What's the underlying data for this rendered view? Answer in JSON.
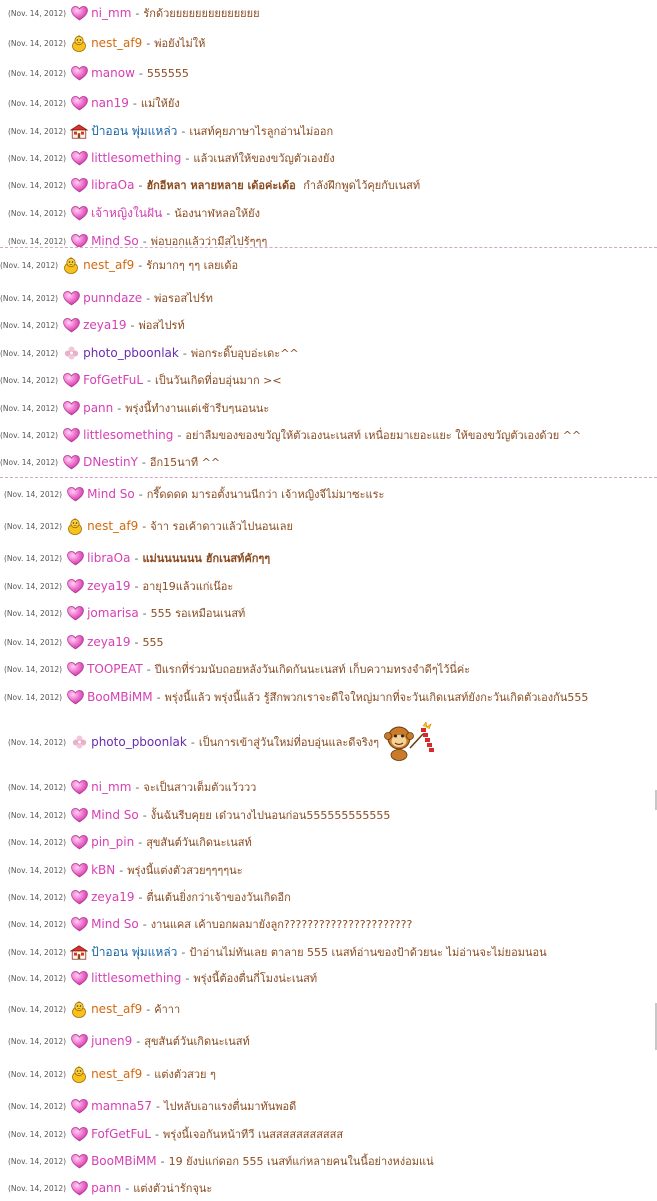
{
  "panels": [
    {
      "rows": [
        {
          "date": "(Nov. 14, 2012)",
          "icon": "heart-icon",
          "name": "ni_mm",
          "color": "pink",
          "msg": "รักด้วยยยยยยยยยยยยยย"
        },
        {
          "date": "(Nov. 14, 2012)",
          "icon": "duck-icon",
          "name": "nest_af9",
          "color": "orange",
          "msg": "พ่อยังไม่ให้"
        },
        {
          "date": "(Nov. 14, 2012)",
          "icon": "heart-icon",
          "name": "manow",
          "color": "pink",
          "msg": "555555"
        },
        {
          "date": "(Nov. 14, 2012)",
          "icon": "heart-icon",
          "name": "nan19",
          "color": "pink",
          "msg": "แม่ให้ยัง"
        },
        {
          "date": "(Nov. 14, 2012)",
          "icon": "house-icon",
          "name": "ป้าออน พุ่มแหล่ว",
          "color": "blue",
          "msg": "เนสท์คุยภาษาไรลูกอ่านไม่ออก"
        },
        {
          "date": "(Nov. 14, 2012)",
          "icon": "heart-icon",
          "name": "littlesomething",
          "color": "pink",
          "msg": "แล้วเนสท์ให้ของขวัญตัวเองยัง"
        },
        {
          "date": "(Nov. 14, 2012)",
          "icon": "heart-icon",
          "name": "libraOa",
          "color": "pink",
          "msg": "ฮักอีหลา หลายหลาย เด้อค่ะเด้อ",
          "msg_tail": "กำลังฝึกพูดไว้คุยกับเนสท์",
          "bold": true
        },
        {
          "date": "(Nov. 14, 2012)",
          "icon": "heart-icon",
          "name": "เจ้าหญิงในฝัน",
          "color": "pink",
          "msg": "น้องนาฬหลอให้ยัง"
        },
        {
          "date": "(Nov. 14, 2012)",
          "icon": "heart-icon",
          "name": "Mind So",
          "color": "pink",
          "msg": "พ่อบอกแล้วว่ามีสไปร้ๆๆๆ"
        }
      ]
    },
    {
      "rows": [
        {
          "date": "(Nov. 14, 2012)",
          "icon": "duck-icon",
          "name": "nest_af9",
          "color": "orange",
          "msg": "รักมากๆ ๆๆ เลยเด้อ"
        },
        {
          "date": "(Nov. 14, 2012)",
          "icon": "heart-icon",
          "name": "punndaze",
          "color": "pink",
          "msg": "พ่อรอสไปร์ท"
        },
        {
          "date": "(Nov. 14, 2012)",
          "icon": "heart-icon",
          "name": "zeya19",
          "color": "pink",
          "msg": "พ่อสไปรท์"
        },
        {
          "date": "(Nov. 14, 2012)",
          "icon": "flower-icon",
          "name": "photo_pboonlak",
          "color": "purple",
          "msg": "พ่อกระดิ๊บอุบอ่ะเดะ^^"
        },
        {
          "date": "(Nov. 14, 2012)",
          "icon": "heart-icon",
          "name": "FofGetFuL",
          "color": "pink",
          "msg": "เป็นวันเกิดที่อบอุ่นมาก ><"
        },
        {
          "date": "(Nov. 14, 2012)",
          "icon": "heart-icon",
          "name": "pann",
          "color": "pink",
          "msg": "พรุ่งนี้ทำงานแต่เช้ารีบๆนอนนะ"
        },
        {
          "date": "(Nov. 14, 2012)",
          "icon": "heart-icon",
          "name": "littlesomething",
          "color": "pink",
          "msg": "อย่าลืมของของขวัญให้ตัวเองนะเนสท์ เหนื่อยมาเยอะแยะ ให้ของขวัญตัวเองด้วย ^^"
        },
        {
          "date": "(Nov. 14, 2012)",
          "icon": "heart-icon",
          "name": "DNestinY",
          "color": "pink",
          "msg": "อีก15นาที ^^"
        }
      ]
    },
    {
      "rows": [
        {
          "date": "(Nov. 14, 2012)",
          "icon": "heart-icon",
          "name": "Mind So",
          "color": "pink",
          "msg": "กรี๊ดดดด มารอตั้งนานนีกว่า เจ้าหญิงจีไม่มาซะแระ"
        },
        {
          "date": "(Nov. 14, 2012)",
          "icon": "duck-icon",
          "name": "nest_af9",
          "color": "orange",
          "msg": "จ้าา รอเค้าดาวแล้วไปนอนเลย"
        },
        {
          "date": "(Nov. 14, 2012)",
          "icon": "heart-icon",
          "name": "libraOa",
          "color": "pink",
          "msg": "แม่นนนนนน ฮักเนสท์คักๆๆ",
          "bold": true
        },
        {
          "date": "(Nov. 14, 2012)",
          "icon": "heart-icon",
          "name": "zeya19",
          "color": "pink",
          "msg": "อายุ19แล้วแก่เน๊อะ"
        },
        {
          "date": "(Nov. 14, 2012)",
          "icon": "heart-icon",
          "name": "jomarisa",
          "color": "pink",
          "msg": "555 รอเหมือนเนสท์"
        },
        {
          "date": "(Nov. 14, 2012)",
          "icon": "heart-icon",
          "name": "zeya19",
          "color": "pink",
          "msg": "555"
        },
        {
          "date": "(Nov. 14, 2012)",
          "icon": "heart-icon",
          "name": "TOOPEAT",
          "color": "pink",
          "msg": "ปีแรกที่ร่วมนับถอยหลังวันเกิดกันนะเนสท์ เก็บความทรงจำดีๆไว้นี่ค่ะ"
        },
        {
          "date": "(Nov. 14, 2012)",
          "icon": "heart-icon",
          "name": "BooMBiMM",
          "color": "pink",
          "msg": "พรุ่งนี้แล้ว พรุ่งนี้แล้ว รู้สึกพวกเราจะดีใจใหญ่มากที่จะวันเกิดเนสท์ยังกะวันเกิดตัวเองกัน555"
        }
      ]
    },
    {
      "rows": [
        {
          "date": "(Nov. 14, 2012)",
          "icon": "flower-icon",
          "name": "photo_pboonlak",
          "color": "purple",
          "msg": "เป็นการเข้าสู่วันใหม่ที่อบอุ่นและดีจริงๆ",
          "emoticon": "monkey-firecracker-icon"
        },
        {
          "date": "(Nov. 14, 2012)",
          "icon": "heart-icon",
          "name": "ni_mm",
          "color": "pink",
          "msg": "จะเป็นสาวเต็มตัวแว้ววว"
        },
        {
          "date": "(Nov. 14, 2012)",
          "icon": "heart-icon",
          "name": "Mind So",
          "color": "pink",
          "msg": "งั้นฉันรีบคุยย เด๋วนางไปนอนก่อน555555555555"
        },
        {
          "date": "(Nov. 14, 2012)",
          "icon": "heart-icon",
          "name": "pin_pin",
          "color": "pink",
          "msg": "สุขสันต์วันเกิดนะเนสท์"
        },
        {
          "date": "(Nov. 14, 2012)",
          "icon": "heart-icon",
          "name": "kBN",
          "color": "pink",
          "msg": "พรุ่งนี้แต่งตัวสวยๆๆๆๆนะ"
        },
        {
          "date": "(Nov. 14, 2012)",
          "icon": "heart-icon",
          "name": "zeya19",
          "color": "pink",
          "msg": "ตื่นเต้นยิ่งกว่าเจ้าของวันเกิดอีก"
        },
        {
          "date": "(Nov. 14, 2012)",
          "icon": "heart-icon",
          "name": "Mind So",
          "color": "pink",
          "msg": "งานแคส เค้าบอกผลมายังลูก??????????????????????"
        },
        {
          "date": "(Nov. 14, 2012)",
          "icon": "house-icon",
          "name": "ป้าออน พุ่มแหล่ว",
          "color": "blue",
          "msg": "ป้าอ่านไม่ทันเลย ตาลาย 555 เนสท์อ่านของป้าด้วยนะ ไม่อ่านจะไม่ยอมนอน"
        },
        {
          "date": "(Nov. 14, 2012)",
          "icon": "heart-icon",
          "name": "littlesomething",
          "color": "pink",
          "msg": "พรุ่งนี้ต้องตื่นกี่โมงน่ะเนสท์"
        },
        {
          "date": "(Nov. 14, 2012)",
          "icon": "duck-icon",
          "name": "nest_af9",
          "color": "orange",
          "msg": "ค้าาา"
        },
        {
          "date": "(Nov. 14, 2012)",
          "icon": "heart-icon",
          "name": "junen9",
          "color": "pink",
          "msg": "สุขสันต์วันเกิดนะเนสท์"
        },
        {
          "date": "(Nov. 14, 2012)",
          "icon": "duck-icon",
          "name": "nest_af9",
          "color": "orange",
          "msg": "แต่งตัวสวย ๆ"
        },
        {
          "date": "(Nov. 14, 2012)",
          "icon": "heart-icon",
          "name": "mamna57",
          "color": "pink",
          "msg": "ไปหลับเอาแรงตื่นมาทันพอดี"
        },
        {
          "date": "(Nov. 14, 2012)",
          "icon": "heart-icon",
          "name": "FofGetFuL",
          "color": "pink",
          "msg": "พรุ่งนี้เจอกันหน้าทีวี เนสสสสสสสสสสส"
        },
        {
          "date": "(Nov. 14, 2012)",
          "icon": "heart-icon",
          "name": "BooMBiMM",
          "color": "pink",
          "msg": "19 ยังบ่แก่ดอก 555 เนสท์แก่หลายคนในนี้อย่างหง่อมแน่"
        },
        {
          "date": "(Nov. 14, 2012)",
          "icon": "heart-icon",
          "name": "pann",
          "color": "pink",
          "msg": "แต่งตัวน่ารักจุนะ"
        }
      ]
    }
  ],
  "separator": "-"
}
